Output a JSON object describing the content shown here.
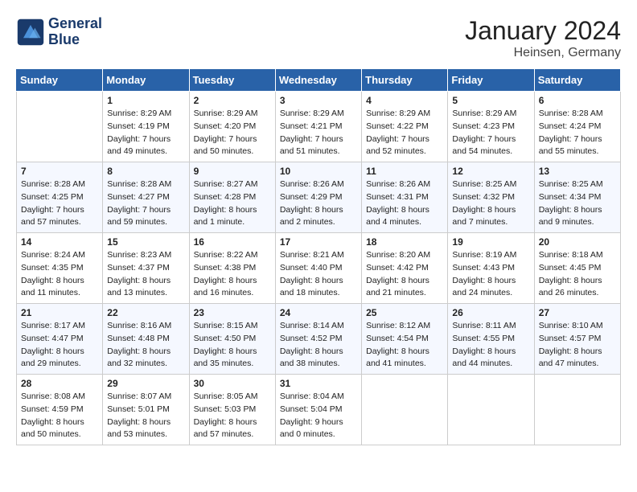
{
  "logo": {
    "line1": "General",
    "line2": "Blue"
  },
  "title": "January 2024",
  "location": "Heinsen, Germany",
  "days_of_week": [
    "Sunday",
    "Monday",
    "Tuesday",
    "Wednesday",
    "Thursday",
    "Friday",
    "Saturday"
  ],
  "weeks": [
    [
      {
        "day": "",
        "sunrise": "",
        "sunset": "",
        "daylight": ""
      },
      {
        "day": "1",
        "sunrise": "Sunrise: 8:29 AM",
        "sunset": "Sunset: 4:19 PM",
        "daylight": "Daylight: 7 hours and 49 minutes."
      },
      {
        "day": "2",
        "sunrise": "Sunrise: 8:29 AM",
        "sunset": "Sunset: 4:20 PM",
        "daylight": "Daylight: 7 hours and 50 minutes."
      },
      {
        "day": "3",
        "sunrise": "Sunrise: 8:29 AM",
        "sunset": "Sunset: 4:21 PM",
        "daylight": "Daylight: 7 hours and 51 minutes."
      },
      {
        "day": "4",
        "sunrise": "Sunrise: 8:29 AM",
        "sunset": "Sunset: 4:22 PM",
        "daylight": "Daylight: 7 hours and 52 minutes."
      },
      {
        "day": "5",
        "sunrise": "Sunrise: 8:29 AM",
        "sunset": "Sunset: 4:23 PM",
        "daylight": "Daylight: 7 hours and 54 minutes."
      },
      {
        "day": "6",
        "sunrise": "Sunrise: 8:28 AM",
        "sunset": "Sunset: 4:24 PM",
        "daylight": "Daylight: 7 hours and 55 minutes."
      }
    ],
    [
      {
        "day": "7",
        "sunrise": "Sunrise: 8:28 AM",
        "sunset": "Sunset: 4:25 PM",
        "daylight": "Daylight: 7 hours and 57 minutes."
      },
      {
        "day": "8",
        "sunrise": "Sunrise: 8:28 AM",
        "sunset": "Sunset: 4:27 PM",
        "daylight": "Daylight: 7 hours and 59 minutes."
      },
      {
        "day": "9",
        "sunrise": "Sunrise: 8:27 AM",
        "sunset": "Sunset: 4:28 PM",
        "daylight": "Daylight: 8 hours and 1 minute."
      },
      {
        "day": "10",
        "sunrise": "Sunrise: 8:26 AM",
        "sunset": "Sunset: 4:29 PM",
        "daylight": "Daylight: 8 hours and 2 minutes."
      },
      {
        "day": "11",
        "sunrise": "Sunrise: 8:26 AM",
        "sunset": "Sunset: 4:31 PM",
        "daylight": "Daylight: 8 hours and 4 minutes."
      },
      {
        "day": "12",
        "sunrise": "Sunrise: 8:25 AM",
        "sunset": "Sunset: 4:32 PM",
        "daylight": "Daylight: 8 hours and 7 minutes."
      },
      {
        "day": "13",
        "sunrise": "Sunrise: 8:25 AM",
        "sunset": "Sunset: 4:34 PM",
        "daylight": "Daylight: 8 hours and 9 minutes."
      }
    ],
    [
      {
        "day": "14",
        "sunrise": "Sunrise: 8:24 AM",
        "sunset": "Sunset: 4:35 PM",
        "daylight": "Daylight: 8 hours and 11 minutes."
      },
      {
        "day": "15",
        "sunrise": "Sunrise: 8:23 AM",
        "sunset": "Sunset: 4:37 PM",
        "daylight": "Daylight: 8 hours and 13 minutes."
      },
      {
        "day": "16",
        "sunrise": "Sunrise: 8:22 AM",
        "sunset": "Sunset: 4:38 PM",
        "daylight": "Daylight: 8 hours and 16 minutes."
      },
      {
        "day": "17",
        "sunrise": "Sunrise: 8:21 AM",
        "sunset": "Sunset: 4:40 PM",
        "daylight": "Daylight: 8 hours and 18 minutes."
      },
      {
        "day": "18",
        "sunrise": "Sunrise: 8:20 AM",
        "sunset": "Sunset: 4:42 PM",
        "daylight": "Daylight: 8 hours and 21 minutes."
      },
      {
        "day": "19",
        "sunrise": "Sunrise: 8:19 AM",
        "sunset": "Sunset: 4:43 PM",
        "daylight": "Daylight: 8 hours and 24 minutes."
      },
      {
        "day": "20",
        "sunrise": "Sunrise: 8:18 AM",
        "sunset": "Sunset: 4:45 PM",
        "daylight": "Daylight: 8 hours and 26 minutes."
      }
    ],
    [
      {
        "day": "21",
        "sunrise": "Sunrise: 8:17 AM",
        "sunset": "Sunset: 4:47 PM",
        "daylight": "Daylight: 8 hours and 29 minutes."
      },
      {
        "day": "22",
        "sunrise": "Sunrise: 8:16 AM",
        "sunset": "Sunset: 4:48 PM",
        "daylight": "Daylight: 8 hours and 32 minutes."
      },
      {
        "day": "23",
        "sunrise": "Sunrise: 8:15 AM",
        "sunset": "Sunset: 4:50 PM",
        "daylight": "Daylight: 8 hours and 35 minutes."
      },
      {
        "day": "24",
        "sunrise": "Sunrise: 8:14 AM",
        "sunset": "Sunset: 4:52 PM",
        "daylight": "Daylight: 8 hours and 38 minutes."
      },
      {
        "day": "25",
        "sunrise": "Sunrise: 8:12 AM",
        "sunset": "Sunset: 4:54 PM",
        "daylight": "Daylight: 8 hours and 41 minutes."
      },
      {
        "day": "26",
        "sunrise": "Sunrise: 8:11 AM",
        "sunset": "Sunset: 4:55 PM",
        "daylight": "Daylight: 8 hours and 44 minutes."
      },
      {
        "day": "27",
        "sunrise": "Sunrise: 8:10 AM",
        "sunset": "Sunset: 4:57 PM",
        "daylight": "Daylight: 8 hours and 47 minutes."
      }
    ],
    [
      {
        "day": "28",
        "sunrise": "Sunrise: 8:08 AM",
        "sunset": "Sunset: 4:59 PM",
        "daylight": "Daylight: 8 hours and 50 minutes."
      },
      {
        "day": "29",
        "sunrise": "Sunrise: 8:07 AM",
        "sunset": "Sunset: 5:01 PM",
        "daylight": "Daylight: 8 hours and 53 minutes."
      },
      {
        "day": "30",
        "sunrise": "Sunrise: 8:05 AM",
        "sunset": "Sunset: 5:03 PM",
        "daylight": "Daylight: 8 hours and 57 minutes."
      },
      {
        "day": "31",
        "sunrise": "Sunrise: 8:04 AM",
        "sunset": "Sunset: 5:04 PM",
        "daylight": "Daylight: 9 hours and 0 minutes."
      },
      {
        "day": "",
        "sunrise": "",
        "sunset": "",
        "daylight": ""
      },
      {
        "day": "",
        "sunrise": "",
        "sunset": "",
        "daylight": ""
      },
      {
        "day": "",
        "sunrise": "",
        "sunset": "",
        "daylight": ""
      }
    ]
  ]
}
